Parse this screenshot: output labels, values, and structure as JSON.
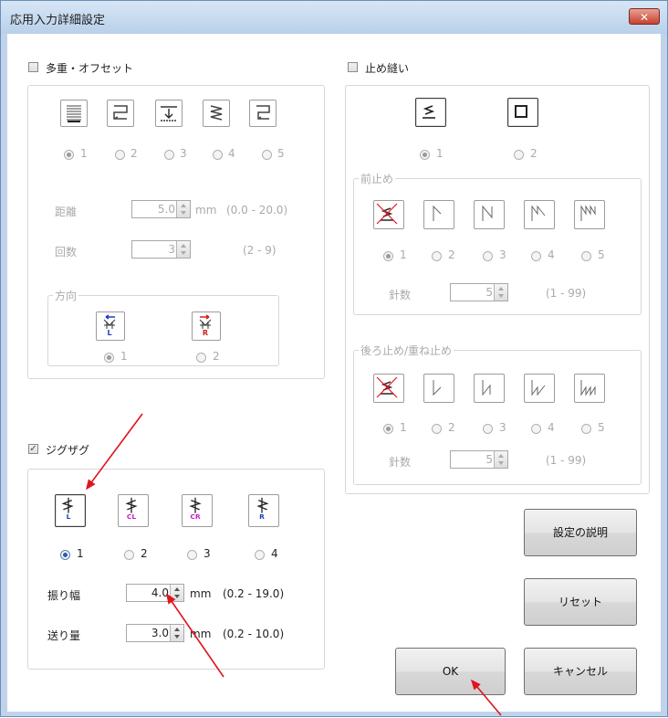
{
  "title": "応用入力詳細設定",
  "close_label": "✕",
  "multi": {
    "checkbox_label": "多重・オフセット",
    "checked": false,
    "radios": [
      "1",
      "2",
      "3",
      "4",
      "5"
    ],
    "selected": 1,
    "distance": {
      "label": "距離",
      "value": "5.0",
      "unit": "mm",
      "range": "(0.0 - 20.0)"
    },
    "count": {
      "label": "回数",
      "value": "3",
      "range": "(2 - 9)"
    },
    "direction": {
      "group_label": "方向",
      "radios": [
        "1",
        "2"
      ],
      "selected": 1,
      "icons": [
        {
          "letter": "L",
          "letter_color": "#1a3fc4"
        },
        {
          "letter": "R",
          "letter_color": "#d0201a"
        }
      ]
    }
  },
  "tack": {
    "checkbox_label": "止め縫い",
    "checked": false,
    "radios": [
      "1",
      "2"
    ],
    "selected": 1,
    "front": {
      "group_label": "前止め",
      "radios": [
        "1",
        "2",
        "3",
        "4",
        "5"
      ],
      "selected": 1,
      "stitch_label": "針数",
      "stitch_value": "5",
      "range": "(1 - 99)"
    },
    "back": {
      "group_label": "後ろ止め/重ね止め",
      "radios": [
        "1",
        "2",
        "3",
        "4",
        "5"
      ],
      "selected": 1,
      "stitch_label": "針数",
      "stitch_value": "5",
      "range": "(1 - 99)"
    }
  },
  "zigzag": {
    "checkbox_label": "ジグザグ",
    "checked": true,
    "radios": [
      "1",
      "2",
      "3",
      "4"
    ],
    "selected": 1,
    "icons": [
      {
        "letter": "L",
        "letter_color": "#1a3fc4"
      },
      {
        "letter": "CL",
        "letter_color": "#c81ec8"
      },
      {
        "letter": "CR",
        "letter_color": "#c81ec8"
      },
      {
        "letter": "R",
        "letter_color": "#1a3fc4"
      }
    ],
    "width": {
      "label": "振り幅",
      "value": "4.0",
      "unit": "mm",
      "range": "(0.2 - 19.0)"
    },
    "feed": {
      "label": "送り量",
      "value": "3.0",
      "unit": "mm",
      "range": "(0.2 - 10.0)"
    }
  },
  "buttons": {
    "explain": "設定の説明",
    "reset": "リセット",
    "ok": "OK",
    "cancel": "キャンセル"
  },
  "colors": {
    "annotation_arrow": "#e0141e",
    "title_bar": "#c6daef"
  }
}
